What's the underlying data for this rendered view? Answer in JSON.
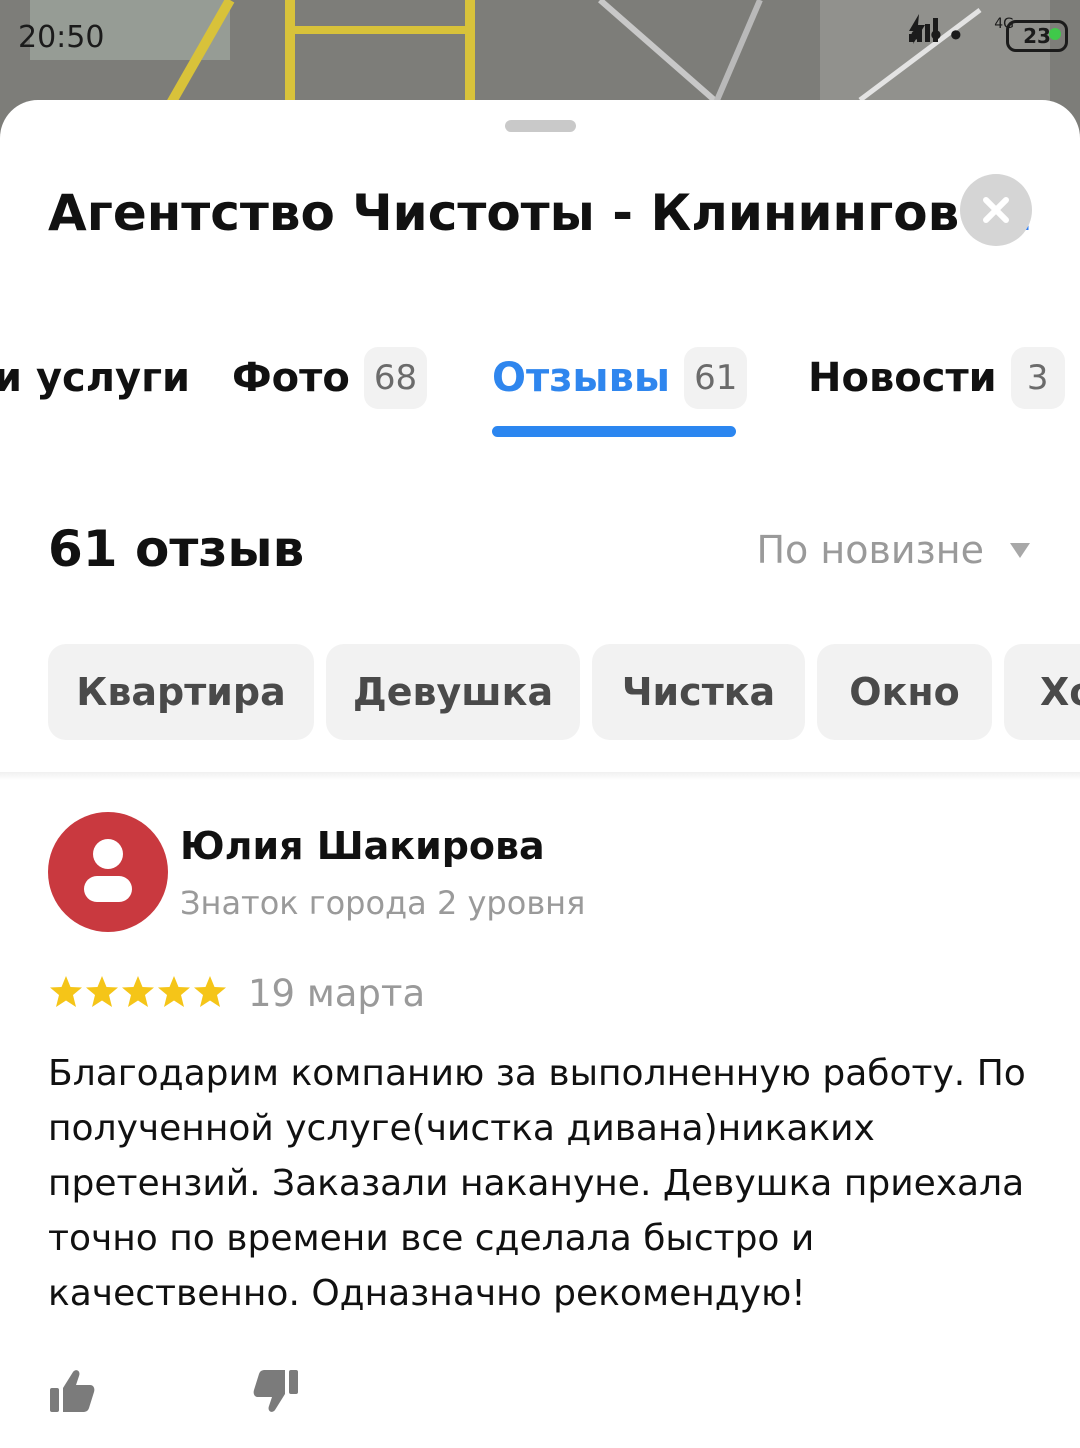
{
  "status_bar": {
    "time": "20:50",
    "network": "4G",
    "battery": "23"
  },
  "header": {
    "title": "Агентство Чистоты - Клинингов",
    "ellipsis": "..."
  },
  "tabs": [
    {
      "label": "и услуги",
      "count": ""
    },
    {
      "label": "Фото",
      "count": "68"
    },
    {
      "label": "Отзывы",
      "count": "61"
    },
    {
      "label": "Новости",
      "count": "3"
    }
  ],
  "reviews": {
    "count_label": "61 отзыв",
    "sort_label": "По новизне"
  },
  "chips": [
    "Квартира",
    "Девушка",
    "Чистка",
    "Окно",
    "Хо"
  ],
  "review": {
    "author_name": "Юлия Шакирова",
    "author_level": "Знаток города 2 уровня",
    "rating": 5,
    "date": "19 марта",
    "text": "Благодарим компанию за выполненную работу. По полученной услуге(чистка дивана)никаких претензий. Заказали накануне. Девушка приехала точно по времени все сделала быстро и качественно. Одназначно рекомендую!"
  },
  "colors": {
    "accent": "#2f86ee",
    "avatar": "#c9393f",
    "star": "#f5c518"
  },
  "icons": [
    "close-icon",
    "chevron-down-icon",
    "user-icon",
    "star-icon",
    "thumbs-up-icon",
    "thumbs-down-icon"
  ]
}
